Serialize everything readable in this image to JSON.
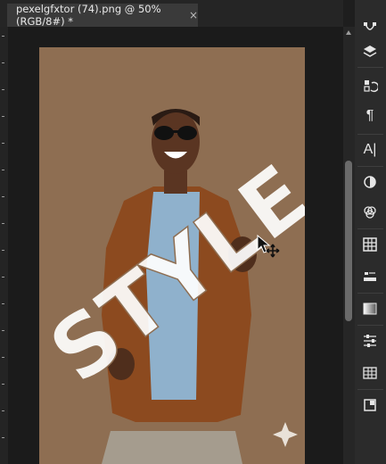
{
  "document_tab": {
    "title": "pexelgfxtor (74).png @ 50% (RGB/8#) *",
    "close_label": "×"
  },
  "canvas": {
    "background_color": "#8e6e52",
    "text_layer": "STYLE"
  },
  "colors": {
    "accent": "#8e6e52",
    "panel": "#2b2b2b",
    "workspace": "#1b1b1b"
  },
  "right_panel": {
    "icons": [
      "paths-icon",
      "layers-icon",
      "history-icon",
      "paragraph-icon",
      "character-icon",
      "adjustments-icon",
      "channels-icon",
      "grid-icon",
      "stamp-icon",
      "gradient-icon",
      "sliders-icon",
      "table-icon",
      "artboard-icon"
    ],
    "character_glyph": "A|",
    "paragraph_glyph": "¶"
  }
}
